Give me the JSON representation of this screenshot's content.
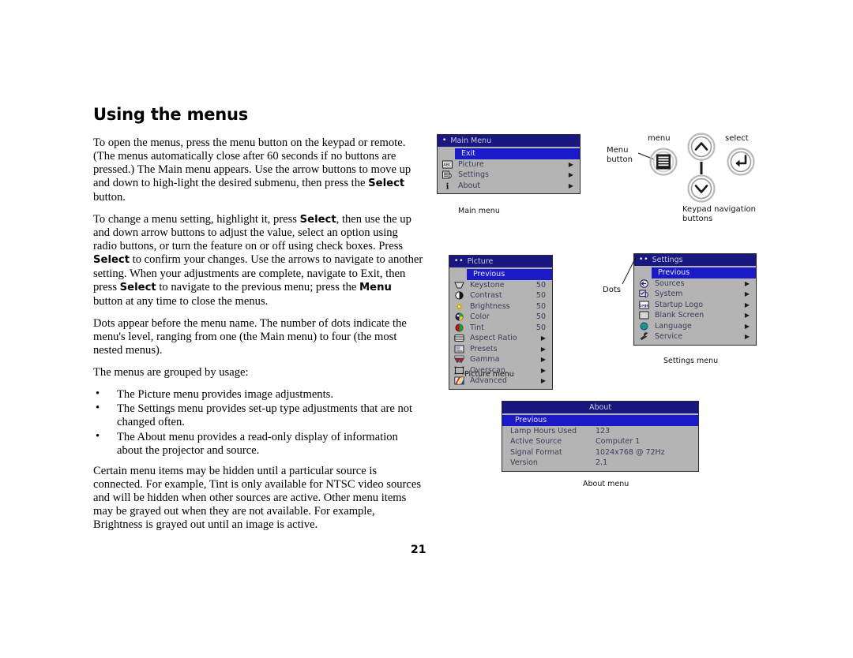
{
  "page": {
    "title": "Using the menus",
    "number": "21"
  },
  "body": {
    "paragraphs": [
      "To open the menus, press the menu button on the keypad or remote. (The menus automatically close after 60 seconds if no buttons are pressed.) The Main menu appears. Use the arrow buttons to move up and down to high-light the desired submenu, then press the ||Select|| button.",
      "To change a menu setting, highlight it, press ||Select||, then use the up and down arrow buttons to adjust the value, select an option using radio buttons, or turn the feature on or off using check boxes. Press ||Select|| to confirm your changes. Use the arrows to navigate to another setting. When your adjustments are complete, navigate to Exit, then press ||Select|| to navigate to the previous menu; press the ||Menu|| button at any time to close the menus.",
      "Dots appear before the menu name. The number of dots indicate the menu's level, ranging from one (the Main menu) to four (the most nested menus).",
      "The menus are grouped by usage:"
    ],
    "bullets": [
      "The Picture menu provides image adjustments.",
      "The Settings menu provides set-up type adjustments that are not changed often.",
      "The About menu provides a read-only display of information about the projector and source."
    ],
    "closing_paragraph": "Certain menu items may be hidden until a particular source is connected. For example, Tint is only available for NTSC video sources and will be hidden when other sources are active. Other menu items may be grayed out when they are not available. For example, Brightness is grayed out until an image is active.",
    "bullet_glyph": "•"
  },
  "main_menu": {
    "dots": "•",
    "title": "Main Menu",
    "caption": "Main menu",
    "rows": [
      {
        "icon": "",
        "label": "Exit",
        "value": "",
        "arrow": "",
        "highlighted": true
      },
      {
        "icon": "abc-box-icon",
        "label": "Picture",
        "value": "",
        "arrow": "▶",
        "highlighted": false
      },
      {
        "icon": "settings-list-icon",
        "label": "Settings",
        "value": "",
        "arrow": "▶",
        "highlighted": false
      },
      {
        "icon": "info-i-icon",
        "label": "About",
        "value": "",
        "arrow": "▶",
        "highlighted": false
      }
    ]
  },
  "picture_menu": {
    "dots": "••",
    "title": "Picture",
    "caption": "Picture menu",
    "rows": [
      {
        "icon": "",
        "label": "Previous",
        "value": "",
        "arrow": "",
        "highlighted": true
      },
      {
        "icon": "keystone-icon",
        "label": "Keystone",
        "value": "50",
        "arrow": "",
        "highlighted": false
      },
      {
        "icon": "contrast-icon",
        "label": "Contrast",
        "value": "50",
        "arrow": "",
        "highlighted": false
      },
      {
        "icon": "brightness-icon",
        "label": "Brightness",
        "value": "50",
        "arrow": "",
        "highlighted": false
      },
      {
        "icon": "color-icon",
        "label": "Color",
        "value": "50",
        "arrow": "",
        "highlighted": false
      },
      {
        "icon": "tint-icon",
        "label": "Tint",
        "value": "50",
        "arrow": "",
        "highlighted": false
      },
      {
        "icon": "aspect-ratio-icon",
        "label": "Aspect Ratio",
        "value": "",
        "arrow": "▶",
        "highlighted": false
      },
      {
        "icon": "presets-icon",
        "label": "Presets",
        "value": "",
        "arrow": "▶",
        "highlighted": false
      },
      {
        "icon": "gamma-icon",
        "label": "Gamma",
        "value": "",
        "arrow": "▶",
        "highlighted": false
      },
      {
        "icon": "overscan-icon",
        "label": "Overscan",
        "value": "",
        "arrow": "▶",
        "highlighted": false
      },
      {
        "icon": "advanced-icon",
        "label": "Advanced",
        "value": "",
        "arrow": "▶",
        "highlighted": false
      }
    ]
  },
  "settings_menu": {
    "dots": "••",
    "title": "Settings",
    "caption": "Settings menu",
    "dots_annotation": "Dots",
    "rows": [
      {
        "icon": "",
        "label": "Previous",
        "value": "",
        "arrow": "",
        "highlighted": true
      },
      {
        "icon": "sources-icon",
        "label": "Sources",
        "value": "",
        "arrow": "▶",
        "highlighted": false
      },
      {
        "icon": "system-icon",
        "label": "System",
        "value": "",
        "arrow": "▶",
        "highlighted": false
      },
      {
        "icon": "startup-logo-icon",
        "label": "Startup Logo",
        "value": "",
        "arrow": "▶",
        "highlighted": false
      },
      {
        "icon": "blank-screen-icon",
        "label": "Blank Screen",
        "value": "",
        "arrow": "▶",
        "highlighted": false
      },
      {
        "icon": "language-globe-icon",
        "label": "Language",
        "value": "",
        "arrow": "▶",
        "highlighted": false
      },
      {
        "icon": "service-wrench-icon",
        "label": "Service",
        "value": "",
        "arrow": "▶",
        "highlighted": false
      }
    ]
  },
  "about_menu": {
    "title": "About",
    "caption": "About menu",
    "rows": [
      {
        "label": "Previous",
        "value": "",
        "highlighted": true
      },
      {
        "label": "Lamp Hours Used",
        "value": "123",
        "highlighted": false
      },
      {
        "label": "Active Source",
        "value": "Computer 1",
        "highlighted": false
      },
      {
        "label": "Signal Format",
        "value": "1024x768 @ 72Hz",
        "highlighted": false
      },
      {
        "label": "Version",
        "value": "2.1",
        "highlighted": false
      }
    ]
  },
  "keypad": {
    "menu_label": "menu",
    "select_label": "select",
    "menu_button_annotation_line1": "Menu",
    "menu_button_annotation_line2": "button",
    "caption_line1": "Keypad navigation",
    "caption_line2": "buttons"
  },
  "colors": {
    "osd_title_bar": "#181880",
    "osd_highlight": "#1a1ac8",
    "osd_body": "#b4b4b4",
    "osd_text": "#3c3c5a"
  }
}
